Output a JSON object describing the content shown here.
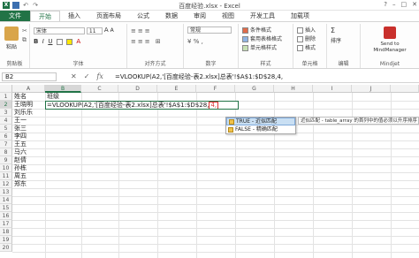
{
  "window": {
    "title": "百度经验.xlsx - Excel",
    "controls": [
      "?",
      "–",
      "□",
      "✕"
    ]
  },
  "tabs": [
    "文件",
    "开始",
    "插入",
    "页面布局",
    "公式",
    "数据",
    "审阅",
    "视图",
    "开发工具",
    "加载项"
  ],
  "ribbon": {
    "clipboard": {
      "label": "剪贴板",
      "paste": "粘贴"
    },
    "font": {
      "label": "字体",
      "font_name": "宋体",
      "font_size": "11"
    },
    "alignment": {
      "label": "对齐方式"
    },
    "number": {
      "label": "数字",
      "format": "常规"
    },
    "styles": {
      "label": "样式",
      "conditional": "条件格式",
      "table": "套用表格格式",
      "cell_styles": "单元格样式"
    },
    "cells": {
      "label": "单元格",
      "insert": "插入",
      "delete": "删除",
      "format": "格式"
    },
    "editing": {
      "label": "编辑",
      "sum": "Σ",
      "sort": "排序"
    },
    "mindjet": {
      "label": "Mindjet",
      "button": "Send to MindManager"
    }
  },
  "formula_bar": {
    "name_box": "B2",
    "formula": "=VLOOKUP(A2,'[百度经验-表2.xlsx]总表'!$A$1:$D$28,4,"
  },
  "columns": [
    "A",
    "B",
    "C",
    "D",
    "E",
    "F",
    "G",
    "H",
    "I",
    "J"
  ],
  "rows": [
    "1",
    "2",
    "3",
    "4",
    "5",
    "6",
    "7",
    "8",
    "9",
    "10",
    "11",
    "12",
    "13",
    "14",
    "15",
    "16",
    "17",
    "18",
    "19",
    "20"
  ],
  "cells": {
    "A1": "姓名",
    "B1": "班级",
    "A2": "王晓明",
    "A3": "刘乐乐",
    "A4": "王一",
    "A5": "张三",
    "A6": "李四",
    "A7": "王五",
    "A8": "马六",
    "A9": "赵倩",
    "A10": "孙栋",
    "A11": "周五",
    "A12": "郑东"
  },
  "editing_cell": {
    "prefix": "=VLOOKUP(A2,'[百度经验-表2.xlsx]总表'!$A$1:$D$28,",
    "highlight": "4,"
  },
  "autocomplete": {
    "items": [
      {
        "label": "TRUE - 近似匹配",
        "selected": true
      },
      {
        "label": "FALSE - 精确匹配",
        "selected": false
      }
    ],
    "tooltip": "近似匹配 - table_array 的首列中的值必须以升序排序"
  },
  "colors": {
    "accent": "#217346",
    "highlight": "#dd3333"
  }
}
